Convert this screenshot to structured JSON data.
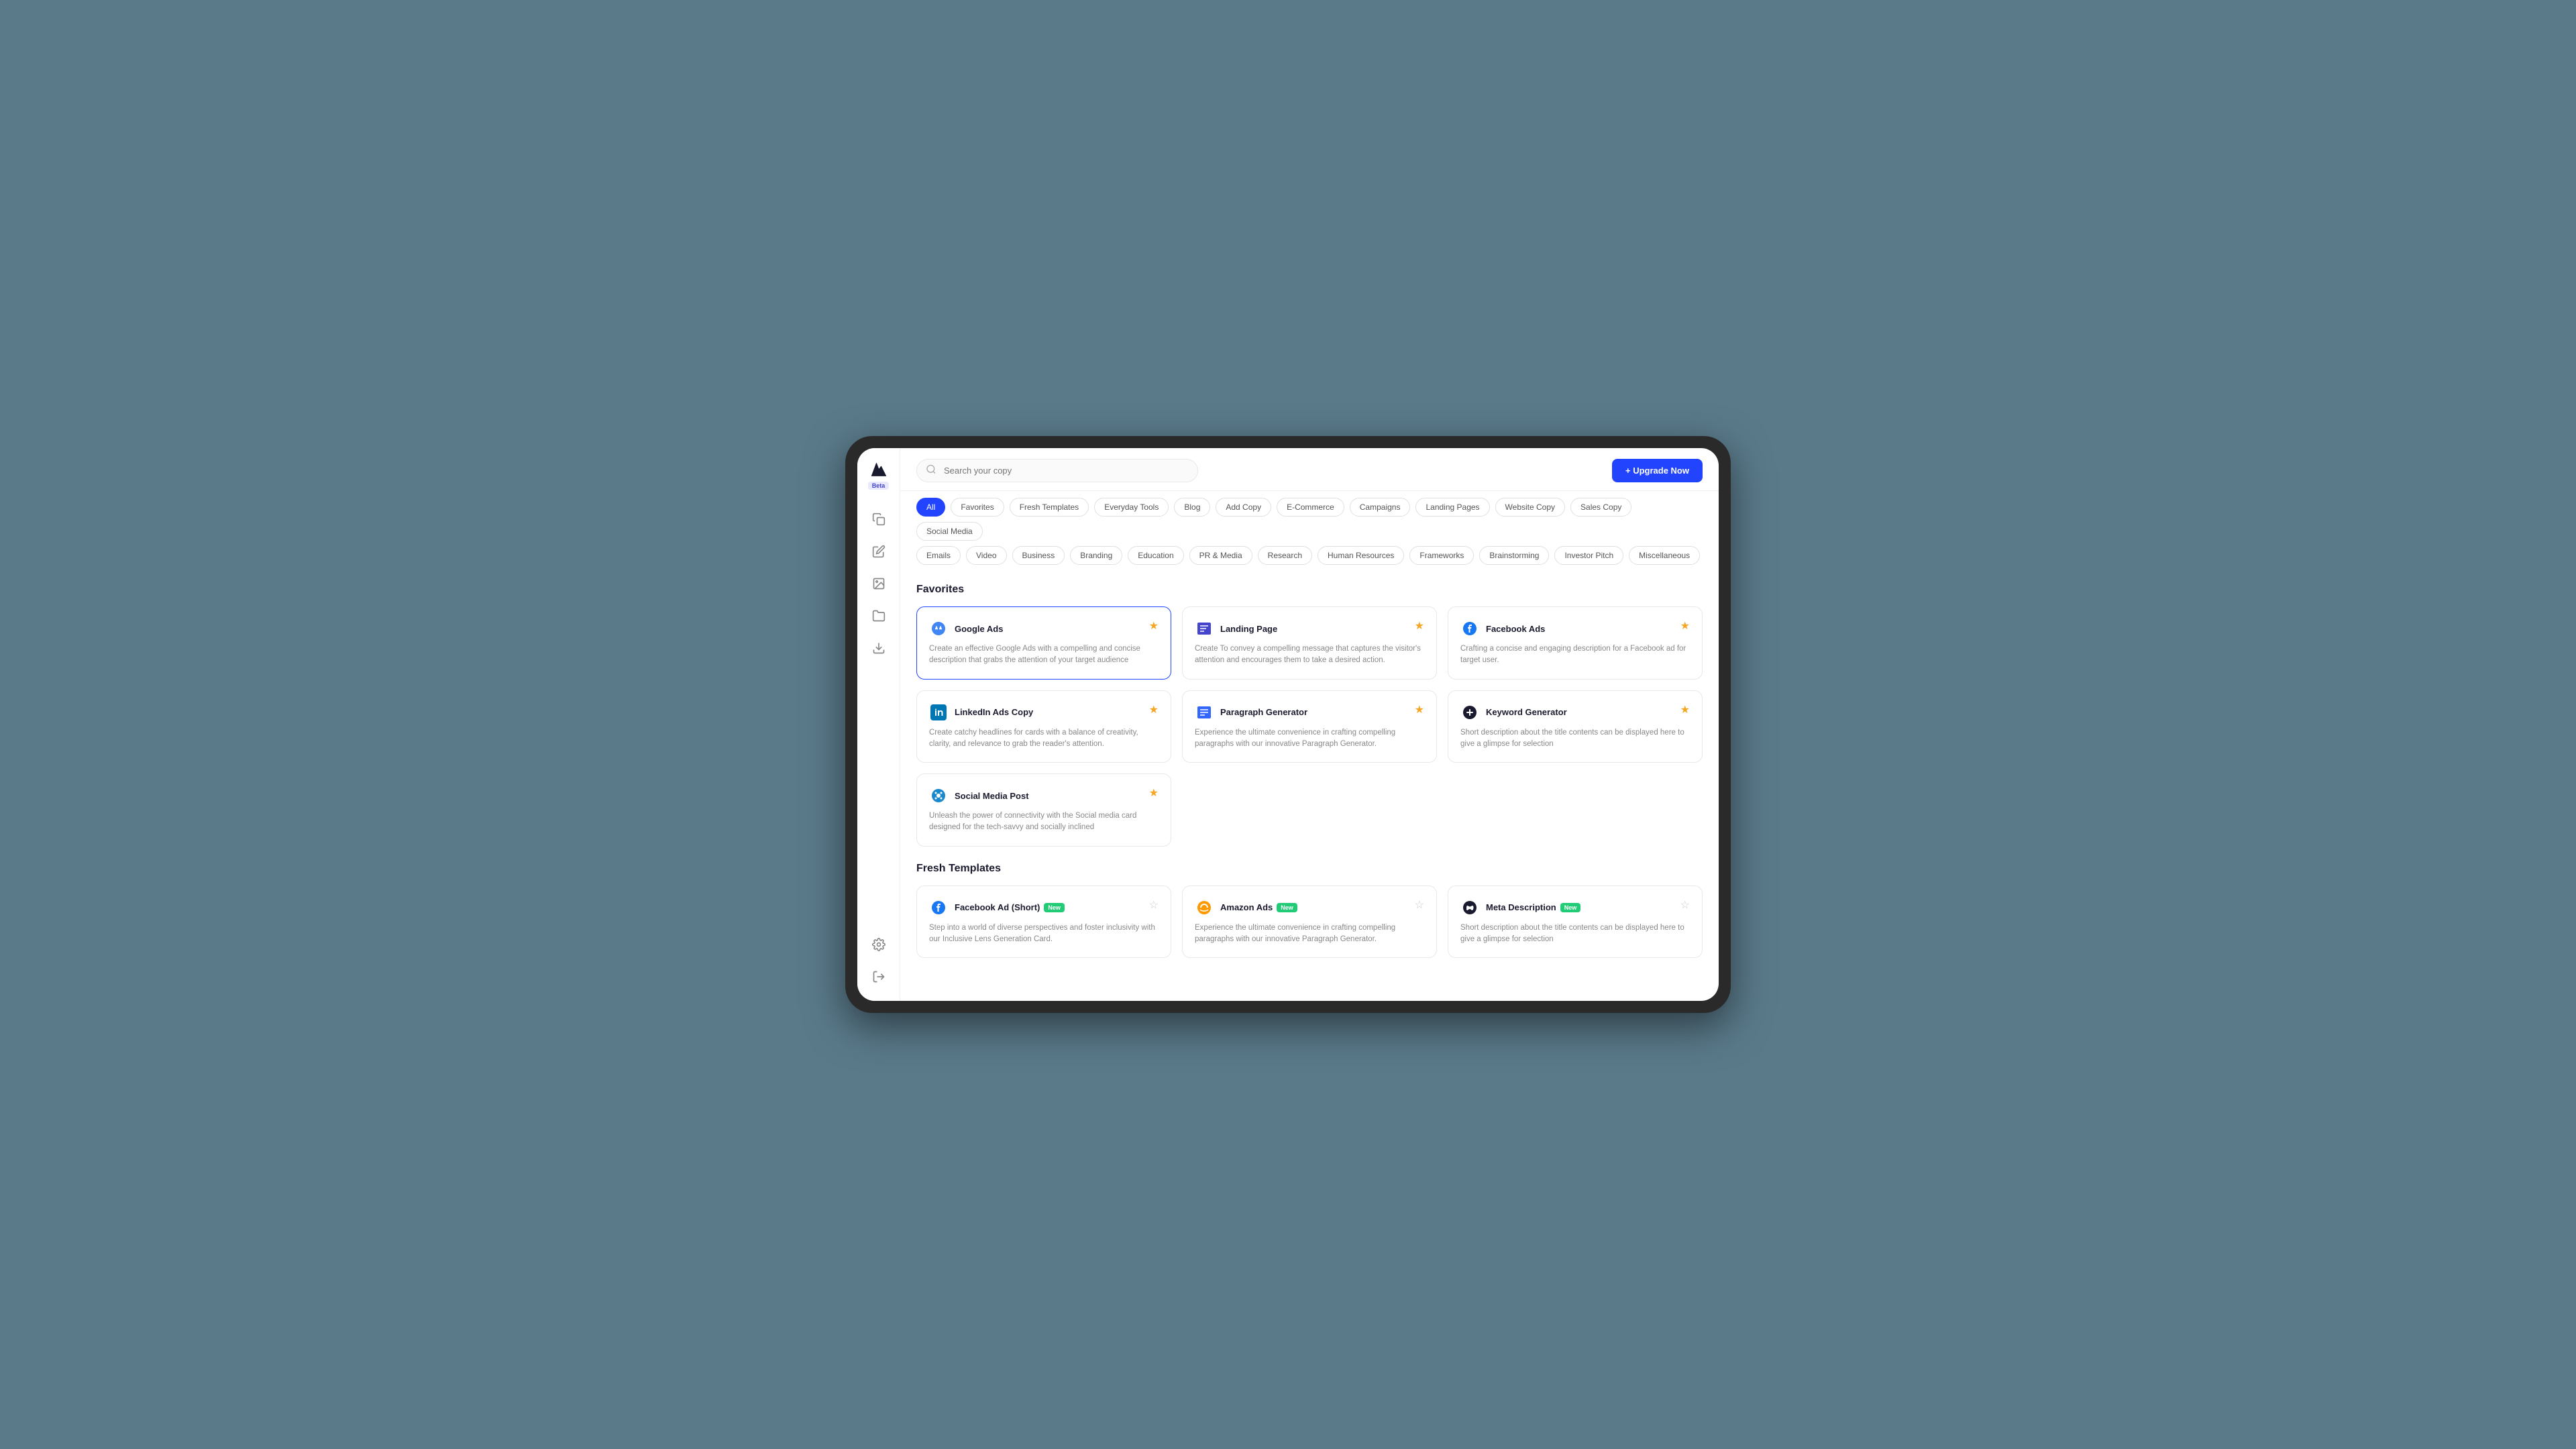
{
  "search": {
    "placeholder": "Search your copy"
  },
  "upgrade_button": "+ Upgrade Now",
  "filter_rows": {
    "row1": [
      {
        "id": "all",
        "label": "All",
        "active": true
      },
      {
        "id": "favorites",
        "label": "Favorites",
        "active": false
      },
      {
        "id": "fresh-templates",
        "label": "Fresh Templates",
        "active": false
      },
      {
        "id": "everyday-tools",
        "label": "Everyday Tools",
        "active": false
      },
      {
        "id": "blog",
        "label": "Blog",
        "active": false
      },
      {
        "id": "add-copy",
        "label": "Add Copy",
        "active": false
      },
      {
        "id": "ecommerce",
        "label": "E-Commerce",
        "active": false
      },
      {
        "id": "campaigns",
        "label": "Campaigns",
        "active": false
      },
      {
        "id": "landing-pages",
        "label": "Landing Pages",
        "active": false
      },
      {
        "id": "website-copy",
        "label": "Website Copy",
        "active": false
      },
      {
        "id": "sales-copy",
        "label": "Sales Copy",
        "active": false
      },
      {
        "id": "social-media",
        "label": "Social Media",
        "active": false
      }
    ],
    "row2": [
      {
        "id": "emails",
        "label": "Emails",
        "active": false
      },
      {
        "id": "video",
        "label": "Video",
        "active": false
      },
      {
        "id": "business",
        "label": "Business",
        "active": false
      },
      {
        "id": "branding",
        "label": "Branding",
        "active": false
      },
      {
        "id": "education",
        "label": "Education",
        "active": false
      },
      {
        "id": "pr-media",
        "label": "PR & Media",
        "active": false
      },
      {
        "id": "research",
        "label": "Research",
        "active": false
      },
      {
        "id": "human-resources",
        "label": "Human Resources",
        "active": false
      },
      {
        "id": "frameworks",
        "label": "Frameworks",
        "active": false
      },
      {
        "id": "brainstorming",
        "label": "Brainstorming",
        "active": false
      },
      {
        "id": "investor-pitch",
        "label": "Investor Pitch",
        "active": false
      },
      {
        "id": "miscellaneous",
        "label": "Miscellaneous",
        "active": false
      }
    ]
  },
  "sections": {
    "favorites": {
      "title": "Favorites",
      "cards": [
        {
          "id": "google-ads",
          "icon": "google-ads",
          "title": "Google Ads",
          "desc": "Create an effective Google Ads with a compelling and concise description that grabs the attention of your target audience",
          "starred": true,
          "selected": true,
          "new": false
        },
        {
          "id": "landing-page",
          "icon": "landing-page",
          "title": "Landing Page",
          "desc": "Create To convey a compelling message that captures the visitor's attention and encourages them to take a desired action.",
          "starred": true,
          "selected": false,
          "new": false
        },
        {
          "id": "facebook-ads",
          "icon": "facebook-ads",
          "title": "Facebook Ads",
          "desc": "Crafting a concise and engaging description for a Facebook ad for target user.",
          "starred": true,
          "selected": false,
          "new": false
        },
        {
          "id": "linkedin-ads",
          "icon": "linkedin-ads",
          "title": "LinkedIn Ads Copy",
          "desc": "Create catchy headlines for cards with a balance of creativity, clarity, and relevance to grab the reader's attention.",
          "starred": true,
          "selected": false,
          "new": false
        },
        {
          "id": "paragraph-generator",
          "icon": "paragraph",
          "title": "Paragraph Generator",
          "desc": "Experience the ultimate convenience in crafting compelling paragraphs with our innovative Paragraph Generator.",
          "starred": true,
          "selected": false,
          "new": false
        },
        {
          "id": "keyword-generator",
          "icon": "keyword",
          "title": "Keyword Generator",
          "desc": "Short description about the title contents can be displayed here to give a glimpse for selection",
          "starred": true,
          "selected": false,
          "new": false
        },
        {
          "id": "social-media-post",
          "icon": "social-media",
          "title": "Social Media Post",
          "desc": "Unleash the power of connectivity with the Social media card designed for the tech-savvy and socially inclined",
          "starred": true,
          "selected": false,
          "new": false
        }
      ]
    },
    "fresh_templates": {
      "title": "Fresh Templates",
      "cards": [
        {
          "id": "facebook-ad-short",
          "icon": "facebook-ads",
          "title": "Facebook Ad (Short)",
          "desc": "Step into a world of diverse perspectives and foster inclusivity with our Inclusive Lens Generation Card.",
          "starred": false,
          "selected": false,
          "new": true
        },
        {
          "id": "amazon-ads",
          "icon": "amazon-ads",
          "title": "Amazon Ads",
          "desc": "Experience the ultimate convenience in crafting compelling paragraphs with our innovative Paragraph Generator.",
          "starred": false,
          "selected": false,
          "new": true
        },
        {
          "id": "meta-description",
          "icon": "meta",
          "title": "Meta Description",
          "desc": "Short description about the title contents can be displayed here to give a glimpse for selection",
          "starred": false,
          "selected": false,
          "new": true
        }
      ]
    }
  },
  "sidebar": {
    "logo": "A",
    "beta": "Beta",
    "nav_icons": [
      "copy",
      "edit",
      "image",
      "folder",
      "download"
    ],
    "bottom_icons": [
      "settings",
      "logout"
    ]
  }
}
